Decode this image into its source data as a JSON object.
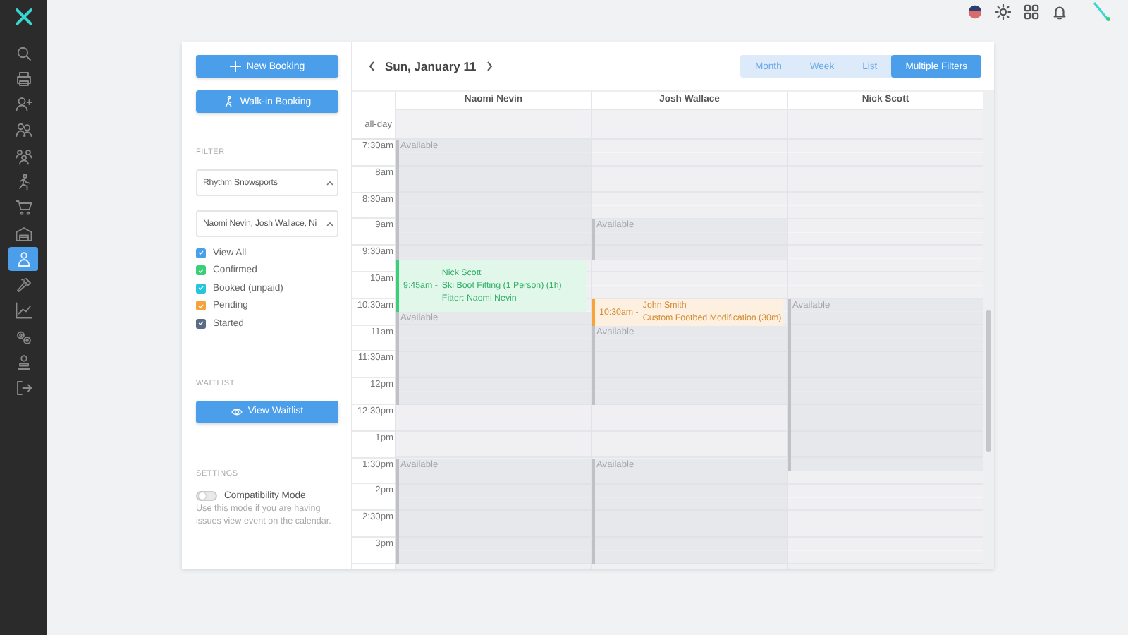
{
  "sidebar": {
    "items": [
      {
        "selected": false
      },
      {
        "selected": false
      },
      {
        "selected": false
      },
      {
        "selected": false
      },
      {
        "selected": false
      },
      {
        "selected": false
      },
      {
        "selected": false
      },
      {
        "selected": false
      },
      {
        "selected": true
      },
      {
        "selected": false
      },
      {
        "selected": false
      },
      {
        "selected": false
      },
      {
        "selected": false
      },
      {
        "selected": false
      }
    ]
  },
  "actions": [
    {
      "kind": "new",
      "label": "New Booking"
    },
    {
      "kind": "walkin",
      "label": "Walk-in Booking"
    }
  ],
  "filters": {
    "heading": "FILTER",
    "location": "Rhythm Snowsports",
    "staff": "Naomi Nevin, Josh Wallace, Ni",
    "statuses": [
      {
        "label": "View All",
        "checked": true,
        "color": "#4a9eea"
      },
      {
        "label": "Confirmed",
        "checked": true,
        "color": "#3ccf7a"
      },
      {
        "label": "Booked (unpaid)",
        "checked": true,
        "color": "#25c6dc"
      },
      {
        "label": "Pending",
        "checked": true,
        "color": "#f7a33b"
      },
      {
        "label": "Started",
        "checked": true,
        "color": "#5a6b86"
      }
    ]
  },
  "waitlist": {
    "heading": "WAITLIST",
    "button": "View Waitlist"
  },
  "settings": {
    "heading": "SETTINGS",
    "compatibility_mode": {
      "label": "Compatibility Mode",
      "on": false,
      "description": "Use this mode if you are having issues view event on the calendar."
    }
  },
  "calendar": {
    "date": "Sun, January 11",
    "view_tabs": [
      {
        "label": "Month",
        "selected": false
      },
      {
        "label": "Week",
        "selected": false
      },
      {
        "label": "List",
        "selected": false
      },
      {
        "label": "Multiple Filters",
        "selected": true
      }
    ],
    "resources": [
      "Naomi Nevin",
      "Josh Wallace",
      "Nick Scott"
    ],
    "all_day_label": "all-day",
    "rows": [
      {
        "time": "7:30am",
        "cells": [
          {
            "kind": "available",
            "label": "Available"
          },
          {
            "kind": "open"
          },
          {
            "kind": "open"
          }
        ]
      },
      {
        "time": "8am",
        "cells": [
          {
            "kind": "available"
          },
          {
            "kind": "open"
          },
          {
            "kind": "open"
          }
        ]
      },
      {
        "time": "8:30am",
        "cells": [
          {
            "kind": "available"
          },
          {
            "kind": "open"
          },
          {
            "kind": "open"
          }
        ]
      },
      {
        "time": "9am",
        "cells": [
          {
            "kind": "available"
          },
          {
            "kind": "available",
            "label": "Available"
          },
          {
            "kind": "open"
          }
        ]
      },
      {
        "time": "9:30am",
        "cells": [
          {
            "kind": "available_booked",
            "event": {
              "time": "9:45am -",
              "color": "#3ccf7a",
              "lines": [
                "Nick Scott",
                "Ski Boot Fitting (1 Person) (1h)",
                "Fitter: Naomi Nevin"
              ]
            }
          },
          {
            "kind": "available_open"
          },
          {
            "kind": "open"
          }
        ]
      },
      {
        "time": "10am",
        "cells": [
          {
            "kind": "booked"
          },
          {
            "kind": "open"
          },
          {
            "kind": "open"
          }
        ]
      },
      {
        "time": "10:30am",
        "cells": [
          {
            "kind": "booked_available",
            "label": "Available"
          },
          {
            "kind": "booked",
            "event": {
              "time": "10:30am -",
              "color": "#f7a33b",
              "lines": [
                "John Smith",
                "Custom Footbed Modification (30m)"
              ]
            }
          },
          {
            "kind": "available",
            "label": "Available"
          }
        ]
      },
      {
        "time": "11am",
        "cells": [
          {
            "kind": "available"
          },
          {
            "kind": "available",
            "label": "Available"
          },
          {
            "kind": "available"
          }
        ]
      },
      {
        "time": "11:30am",
        "cells": [
          {
            "kind": "available"
          },
          {
            "kind": "available"
          },
          {
            "kind": "available"
          }
        ]
      },
      {
        "time": "12pm",
        "cells": [
          {
            "kind": "available"
          },
          {
            "kind": "available"
          },
          {
            "kind": "available"
          }
        ]
      },
      {
        "time": "12:30pm",
        "cells": [
          {
            "kind": "open"
          },
          {
            "kind": "open"
          },
          {
            "kind": "available"
          }
        ]
      },
      {
        "time": "1pm",
        "cells": [
          {
            "kind": "open"
          },
          {
            "kind": "open"
          },
          {
            "kind": "available"
          }
        ]
      },
      {
        "time": "1:30pm",
        "cells": [
          {
            "kind": "available",
            "label": "Available"
          },
          {
            "kind": "available",
            "label": "Available"
          },
          {
            "kind": "available_open"
          }
        ]
      },
      {
        "time": "2pm",
        "cells": [
          {
            "kind": "available"
          },
          {
            "kind": "available"
          },
          {
            "kind": "open"
          }
        ]
      },
      {
        "time": "2:30pm",
        "cells": [
          {
            "kind": "available"
          },
          {
            "kind": "available"
          },
          {
            "kind": "open"
          }
        ]
      },
      {
        "time": "3pm",
        "cells": [
          {
            "kind": "available"
          },
          {
            "kind": "available"
          },
          {
            "kind": "open"
          }
        ]
      }
    ]
  }
}
